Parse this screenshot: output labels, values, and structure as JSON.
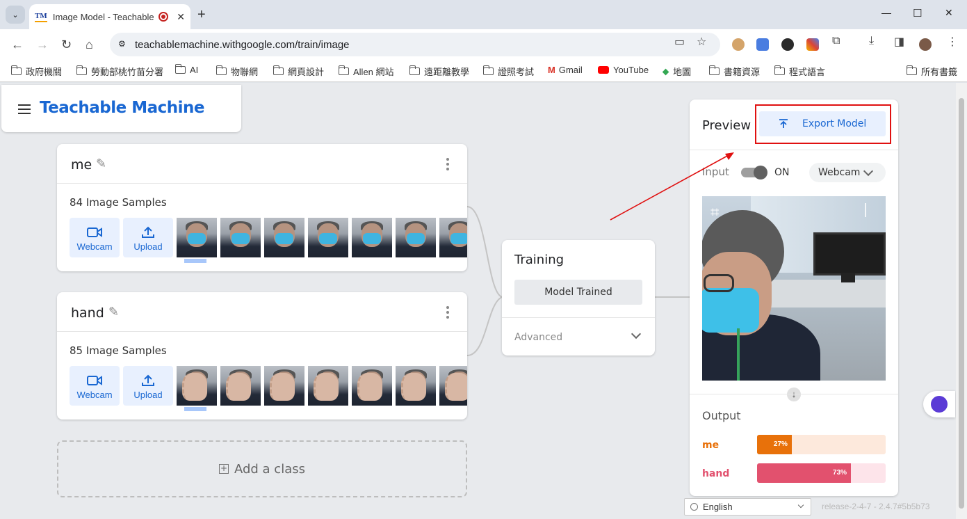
{
  "browser": {
    "tab_title": "Image Model - Teachable",
    "tab_favicon": "TM",
    "url": "teachablemachine.withgoogle.com/train/image",
    "bookmarks": [
      "政府機關",
      "勞動部桃竹苗分署",
      "AI",
      "物聯網",
      "網頁設計",
      "Allen 網站",
      "遠距離教學",
      "證照考試",
      "Gmail",
      "YouTube",
      "地圖",
      "書籍資源",
      "程式語言"
    ],
    "other_bookmarks": "所有書籤"
  },
  "app": {
    "title": "Teachable Machine",
    "accent_color": "#1967d2"
  },
  "classes": [
    {
      "name": "me",
      "samples": "84 Image Samples",
      "webcam_label": "Webcam",
      "upload_label": "Upload"
    },
    {
      "name": "hand",
      "samples": "85 Image Samples",
      "webcam_label": "Webcam",
      "upload_label": "Upload"
    }
  ],
  "add_class_label": "Add a class",
  "training": {
    "title": "Training",
    "button_label": "Model Trained",
    "advanced_label": "Advanced"
  },
  "preview": {
    "title": "Preview",
    "export_label": "Export Model",
    "input_label": "Input",
    "toggle_state": "ON",
    "source_label": "Webcam",
    "output_title": "Output",
    "outputs": [
      {
        "label": "me",
        "value": 0.27,
        "text": "27%",
        "color": "#e8710a",
        "bg": "#fde9dc"
      },
      {
        "label": "hand",
        "value": 0.73,
        "text": "73%",
        "color": "#e2516e",
        "bg": "#fde4ea"
      }
    ]
  },
  "footer": {
    "language": "English",
    "release": "release-2-4-7 - 2.4.7#5b5b73"
  }
}
